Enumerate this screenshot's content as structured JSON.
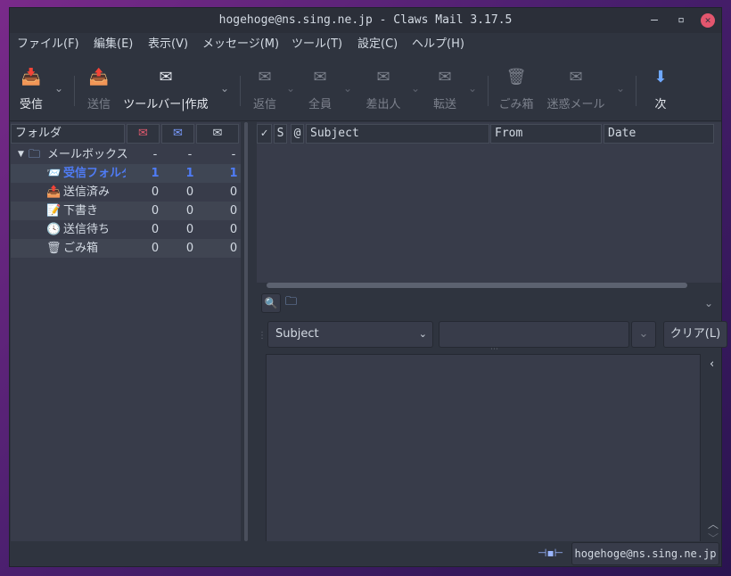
{
  "window": {
    "title": "hogehoge@ns.sing.ne.jp - Claws Mail 3.17.5",
    "minimize": "–",
    "maximize": "▫",
    "close": "✕"
  },
  "menu": [
    "ファイル(F)",
    "編集(E)",
    "表示(V)",
    "メッセージ(M)",
    "ツール(T)",
    "設定(C)",
    "ヘルプ(H)"
  ],
  "toolbar": {
    "receive": "受信",
    "send": "送信",
    "compose": "ツールバー|作成",
    "reply": "返信",
    "reply_all": "全員",
    "reply_sender": "差出人",
    "forward": "転送",
    "trash": "ごみ箱",
    "spam": "迷惑メール",
    "next": "次"
  },
  "folders": {
    "header": "フォルダ",
    "rows": [
      {
        "name": "メールボックス",
        "new": "-",
        "unread": "-",
        "total": "-"
      },
      {
        "name": "受信フォルダ",
        "new": "1",
        "unread": "1",
        "total": "1"
      },
      {
        "name": "送信済み",
        "new": "0",
        "unread": "0",
        "total": "0"
      },
      {
        "name": "下書き",
        "new": "0",
        "unread": "0",
        "total": "0"
      },
      {
        "name": "送信待ち",
        "new": "0",
        "unread": "0",
        "total": "0"
      },
      {
        "name": "ごみ箱",
        "new": "0",
        "unread": "0",
        "total": "0"
      }
    ]
  },
  "messagelist": {
    "cols": {
      "check": "✓",
      "status": "S",
      "attach": "@",
      "subject": "Subject",
      "from": "From",
      "date": "Date"
    }
  },
  "search": {
    "field": "Subject",
    "query": "",
    "clear": "クリア(L)"
  },
  "status": {
    "account": "hogehoge@ns.sing.ne.jp"
  }
}
